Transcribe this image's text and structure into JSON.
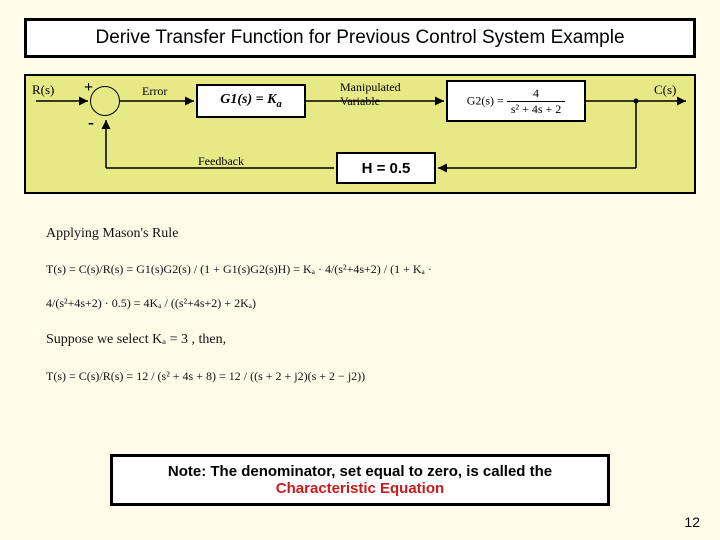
{
  "title": "Derive Transfer Function for Previous Control System Example",
  "diagram": {
    "input": "R(s)",
    "output": "C(s)",
    "sum_plus": "+",
    "sum_minus": "-",
    "error_label": "Error",
    "manip_label_1": "Manipulated",
    "manip_label_2": "Variable",
    "feedback_label": "Feedback",
    "g1_text": "G1(s) = K",
    "g1_sub": "a",
    "g2_num": "4",
    "g2_den": "s² + 4s + 2",
    "g2_prefix": "G2(s) = ",
    "h_text": "H = 0.5"
  },
  "derivation": {
    "line1": "Applying Mason's Rule",
    "eq1_lhs": "T(s) = C(s)/R(s) = G1(s)G2(s) / (1 + G1(s)G2(s)H)  =  Kₐ · 4/(s²+4s+2)  /  (1 + Kₐ · 4/(s²+4s+2) · 0.5)  =  4Kₐ / ((s²+4s+2) + 2Kₐ)",
    "line2": "Suppose we select Kₐ = 3 ,  then,",
    "eq2": "T(s) = C(s)/R(s) = 12 / (s² + 4s + 8) = 12 / ((s + 2 + j2)(s + 2 − j2))"
  },
  "note": {
    "pre": "Note: The denominator, set equal to zero, is called the ",
    "char": "Characteristic Equation"
  },
  "page": "12",
  "chart_data": {
    "type": "diagram",
    "nodes": [
      {
        "id": "R",
        "kind": "signal",
        "label": "R(s)"
      },
      {
        "id": "sum",
        "kind": "summing-junction",
        "inputs": [
          "+",
          "-"
        ]
      },
      {
        "id": "G1",
        "kind": "block",
        "label": "G1(s) = Ka"
      },
      {
        "id": "G2",
        "kind": "block",
        "label": "G2(s) = 4 / (s^2 + 4s + 2)"
      },
      {
        "id": "C",
        "kind": "signal",
        "label": "C(s)"
      },
      {
        "id": "H",
        "kind": "block",
        "label": "H = 0.5"
      }
    ],
    "edges": [
      {
        "from": "R",
        "to": "sum",
        "label": ""
      },
      {
        "from": "sum",
        "to": "G1",
        "label": "Error"
      },
      {
        "from": "G1",
        "to": "G2",
        "label": "Manipulated Variable"
      },
      {
        "from": "G2",
        "to": "C",
        "label": ""
      },
      {
        "from": "C",
        "to": "H",
        "label": ""
      },
      {
        "from": "H",
        "to": "sum",
        "label": "Feedback",
        "sign": "-"
      }
    ],
    "closed_loop": "T(s) = 4Ka / ((s^2 + 4s + 2) + 2Ka)",
    "example_Ka": 3,
    "example_Ts": "12 / (s^2 + 4s + 8)",
    "poles": [
      "-2 + j2",
      "-2 - j2"
    ]
  }
}
